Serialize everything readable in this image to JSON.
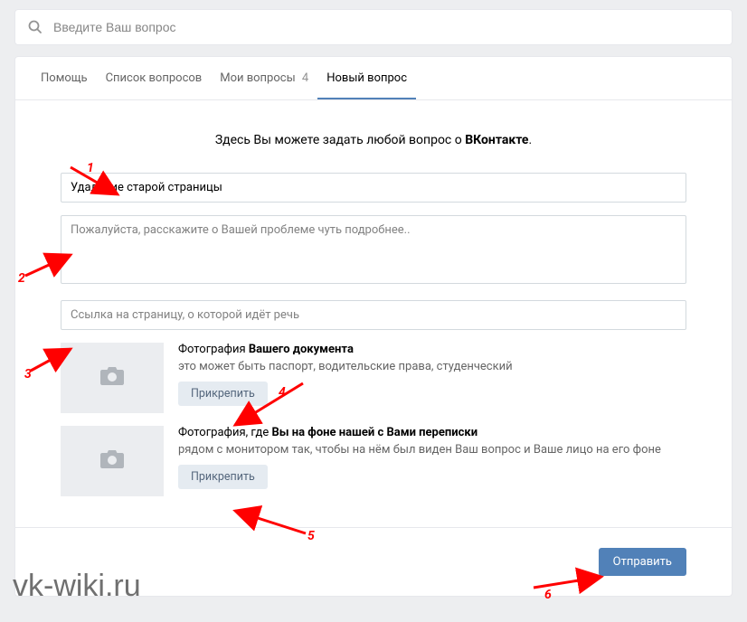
{
  "search": {
    "placeholder": "Введите Ваш вопрос"
  },
  "tabs": {
    "help": "Помощь",
    "list": "Список вопросов",
    "mine": "Мои вопросы",
    "mine_count": "4",
    "new": "Новый вопрос"
  },
  "form": {
    "heading_pre": "Здесь Вы можете задать любой вопрос о ",
    "heading_bold": "ВКонтакте",
    "heading_post": ".",
    "subject_value": "Удаление старой страницы",
    "details_placeholder": "Пожалуйста, расскажите о Вашей проблеме чуть подробнее..",
    "link_placeholder": "Ссылка на страницу, о которой идёт речь"
  },
  "attach1": {
    "title_pre": "Фотография ",
    "title_bold": "Вашего документа",
    "desc": "это может быть паспорт, водительские права, студенческий",
    "btn": "Прикрепить"
  },
  "attach2": {
    "title_pre": "Фотография, где ",
    "title_bold": "Вы на фоне нашей с Вами переписки",
    "desc": "рядом с монитором так, чтобы на нём был виден Ваш вопрос и Ваше лицо на его фоне",
    "btn": "Прикрепить"
  },
  "submit": "Отправить",
  "watermark": "vk-wiki.ru",
  "annotations": {
    "n1": "1",
    "n2": "2",
    "n3": "3",
    "n4": "4",
    "n5": "5",
    "n6": "6"
  }
}
